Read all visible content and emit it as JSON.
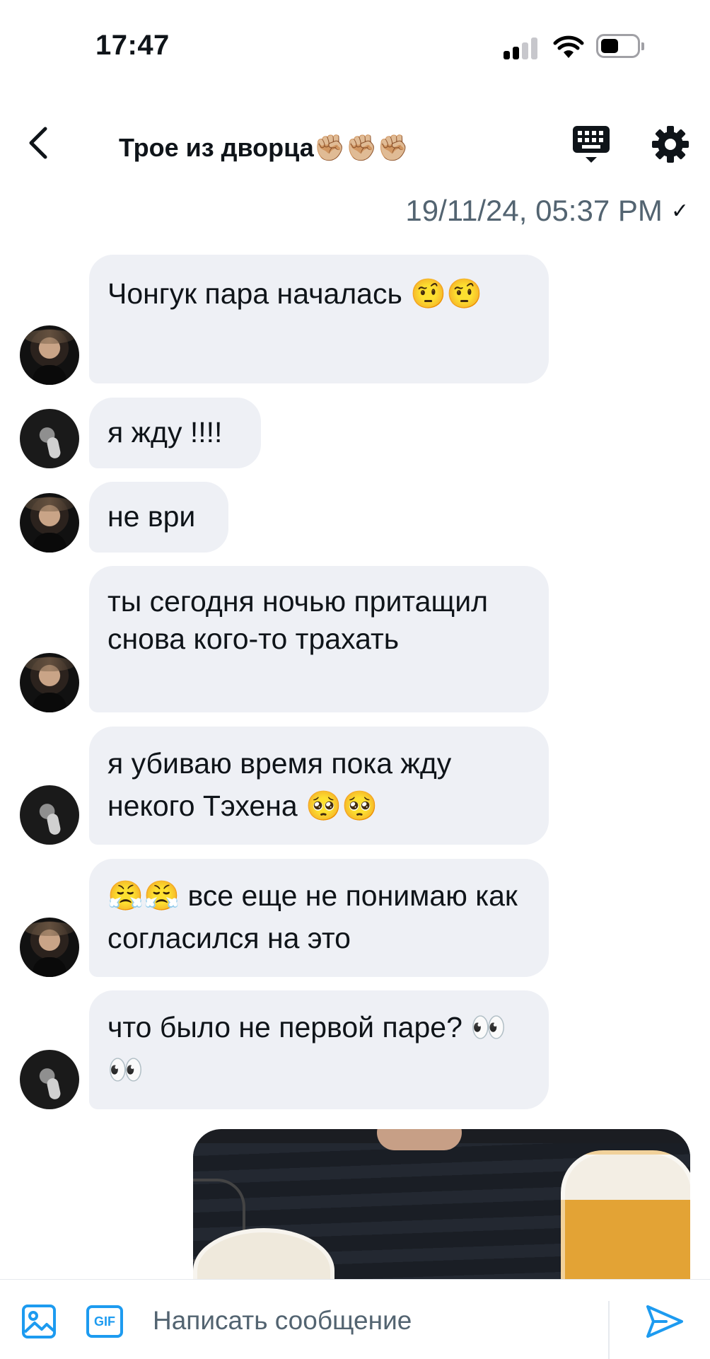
{
  "status_bar": {
    "time": "17:47"
  },
  "header": {
    "title": "Трое из дворца✊🏼✊🏼✊🏼",
    "back_icon": "chevron-left-icon",
    "keyboard_icon": "keyboard-icon",
    "settings_icon": "gear-icon"
  },
  "timestamp": {
    "text": "19/11/24, 05:37 PM",
    "check": "✓"
  },
  "messages": [
    {
      "sender": "a",
      "text": "Чонгук пара началась 🤨🤨"
    },
    {
      "sender": "b",
      "text": "я жду !!!!"
    },
    {
      "sender": "a",
      "text": "не ври"
    },
    {
      "sender": "a",
      "text": "ты сегодня ночью притащил снова кого-то трахать"
    },
    {
      "sender": "b",
      "text": "я убиваю время пока жду некого Тэхена 🥺🥺"
    },
    {
      "sender": "a",
      "text": "😤😤 все еще не понимаю как согласился на это"
    },
    {
      "sender": "b",
      "text": "что было не первой паре? 👀👀"
    }
  ],
  "composer": {
    "placeholder": "Написать сообщение",
    "value": "",
    "gif_label": "GIF",
    "media_icon": "image-icon",
    "send_icon": "send-icon"
  },
  "colors": {
    "accent": "#1d9bf0",
    "bubble": "#eef0f5",
    "secondary_text": "#536471"
  }
}
